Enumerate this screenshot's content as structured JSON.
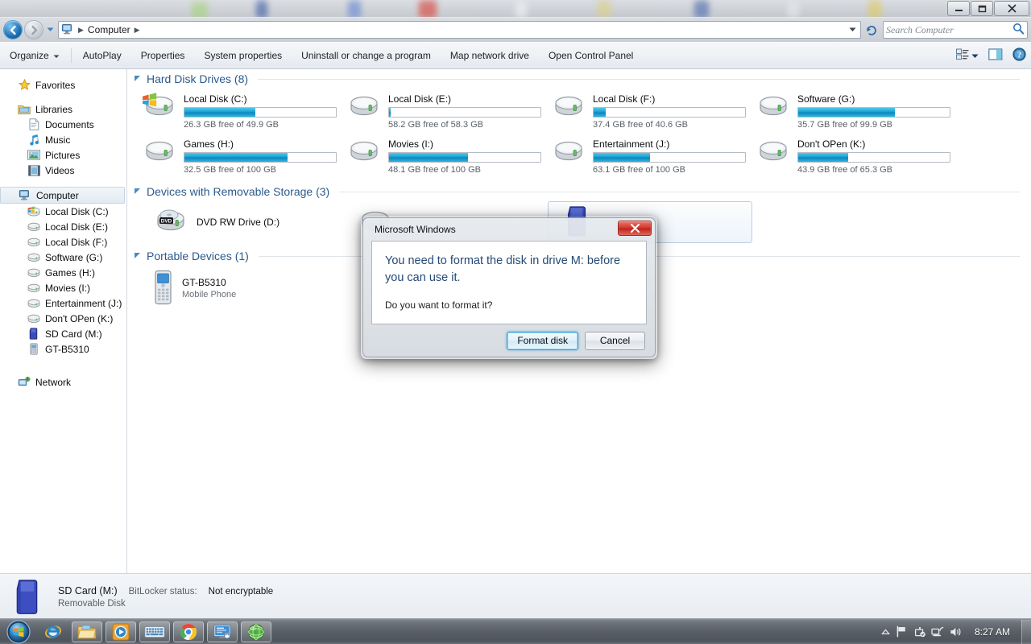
{
  "window": {
    "title": "Computer",
    "controls": {
      "minimize": "minimize-icon",
      "maximize": "maximize-icon",
      "close": "close-icon"
    }
  },
  "address": {
    "root_icon": "computer-icon",
    "crumb": "Computer",
    "dropdown_icon": "chevron-down-icon",
    "refresh_icon": "refresh-icon",
    "back_icon": "back-arrow-icon",
    "forward_icon": "forward-arrow-icon",
    "history_icon": "history-chevron-icon"
  },
  "search": {
    "placeholder": "Search Computer",
    "icon": "search-icon"
  },
  "commandbar": {
    "items": [
      {
        "label": "Organize",
        "has_dropdown": true
      },
      {
        "label": "AutoPlay",
        "has_dropdown": false
      },
      {
        "label": "Properties",
        "has_dropdown": false
      },
      {
        "label": "System properties",
        "has_dropdown": false
      },
      {
        "label": "Uninstall or change a program",
        "has_dropdown": false
      },
      {
        "label": "Map network drive",
        "has_dropdown": false
      },
      {
        "label": "Open Control Panel",
        "has_dropdown": false
      }
    ],
    "view_icon": "view-list-icon",
    "view_dropdown_icon": "chevron-down-icon",
    "preview_icon": "preview-pane-icon",
    "help_icon": "help-icon"
  },
  "sidebar": {
    "groups": [
      {
        "label": "Favorites",
        "icon": "star-icon",
        "items": []
      },
      {
        "label": "Libraries",
        "icon": "libraries-icon",
        "items": [
          {
            "label": "Documents",
            "icon": "document-icon"
          },
          {
            "label": "Music",
            "icon": "music-icon"
          },
          {
            "label": "Pictures",
            "icon": "pictures-icon"
          },
          {
            "label": "Videos",
            "icon": "videos-icon"
          }
        ]
      },
      {
        "label": "Computer",
        "icon": "computer-icon",
        "selected": true,
        "items": [
          {
            "label": "Local Disk (C:)",
            "icon": "windows-drive-icon"
          },
          {
            "label": "Local Disk (E:)",
            "icon": "drive-icon"
          },
          {
            "label": "Local Disk (F:)",
            "icon": "drive-icon"
          },
          {
            "label": "Software (G:)",
            "icon": "drive-icon"
          },
          {
            "label": "Games (H:)",
            "icon": "drive-icon"
          },
          {
            "label": "Movies (I:)",
            "icon": "drive-icon"
          },
          {
            "label": "Entertainment (J:)",
            "icon": "drive-icon"
          },
          {
            "label": "Don't OPen (K:)",
            "icon": "drive-icon"
          },
          {
            "label": "SD Card (M:)",
            "icon": "sdcard-icon"
          },
          {
            "label": "GT-B5310",
            "icon": "phone-icon"
          }
        ]
      },
      {
        "label": "Network",
        "icon": "network-icon",
        "items": []
      }
    ]
  },
  "main": {
    "groups": [
      {
        "title": "Hard Disk Drives (8)",
        "expanded": true
      },
      {
        "title": "Devices with Removable Storage (3)",
        "expanded": true
      },
      {
        "title": "Portable Devices (1)",
        "expanded": true
      }
    ],
    "drives": [
      {
        "name": "Local Disk (C:)",
        "size_text": "26.3 GB free of 49.9 GB",
        "fill_pct": 47,
        "icon": "windows-drive-icon"
      },
      {
        "name": "Local Disk (E:)",
        "size_text": "58.2 GB free of 58.3 GB",
        "fill_pct": 1,
        "icon": "drive-icon"
      },
      {
        "name": "Local Disk (F:)",
        "size_text": "37.4 GB free of 40.6 GB",
        "fill_pct": 8,
        "icon": "drive-icon"
      },
      {
        "name": "Software (G:)",
        "size_text": "35.7 GB free of 99.9 GB",
        "fill_pct": 64,
        "icon": "drive-icon"
      },
      {
        "name": "Games (H:)",
        "size_text": "32.5 GB free of 100 GB",
        "fill_pct": 68,
        "icon": "drive-icon"
      },
      {
        "name": "Movies (I:)",
        "size_text": "48.1 GB free of 100 GB",
        "fill_pct": 52,
        "icon": "drive-icon"
      },
      {
        "name": "Entertainment (J:)",
        "size_text": "63.1 GB free of 100 GB",
        "fill_pct": 37,
        "icon": "drive-icon"
      },
      {
        "name": "Don't OPen (K:)",
        "size_text": "43.9 GB free of 65.3 GB",
        "fill_pct": 33,
        "icon": "drive-icon"
      }
    ],
    "removable": [
      {
        "name": "DVD RW Drive (D:)",
        "sub": "",
        "icon": "dvd-drive-icon"
      },
      {
        "name": "",
        "sub": "",
        "icon": "drive-icon"
      },
      {
        "name": "",
        "sub": "",
        "icon": "sdcard-icon",
        "selected": true
      }
    ],
    "portable": [
      {
        "name": "GT-B5310",
        "sub": "Mobile Phone",
        "icon": "phone-icon"
      }
    ]
  },
  "details": {
    "icon": "sdcard-icon",
    "title": "SD Card (M:)",
    "bitlocker_label": "BitLocker status:",
    "bitlocker_value": "Not encryptable",
    "subtitle": "Removable Disk"
  },
  "dialog": {
    "title": "Microsoft Windows",
    "close_icon": "close-icon",
    "message": "You need to format the disk in drive M: before you can use it.",
    "question": "Do you want to format it?",
    "buttons": [
      {
        "label": "Format disk",
        "default": true
      },
      {
        "label": "Cancel",
        "default": false
      }
    ]
  },
  "taskbar": {
    "start_icon": "windows-start-orb",
    "apps": [
      {
        "icon": "internet-explorer-icon",
        "active": false
      },
      {
        "icon": "file-explorer-icon",
        "active": true
      },
      {
        "icon": "media-player-icon",
        "active": true
      },
      {
        "icon": "on-screen-keyboard-icon",
        "active": true
      },
      {
        "icon": "chrome-icon",
        "active": true
      },
      {
        "icon": "remote-desktop-icon",
        "active": true
      },
      {
        "icon": "green-globe-icon",
        "active": true
      }
    ],
    "tray": [
      {
        "icon": "show-hidden-icons-icon"
      },
      {
        "icon": "action-center-flag-icon"
      },
      {
        "icon": "safely-remove-hardware-icon"
      },
      {
        "icon": "network-icon"
      },
      {
        "icon": "volume-icon"
      }
    ],
    "clock": "8:27 AM",
    "show_desktop": "show-desktop-button"
  },
  "colors": {
    "accent": "#2b5a8c",
    "capacity_bar": "#1ba4d6",
    "capacity_bar_red": "#d4362a",
    "close_button": "#d4362a",
    "dialog_text": "#254a74"
  }
}
